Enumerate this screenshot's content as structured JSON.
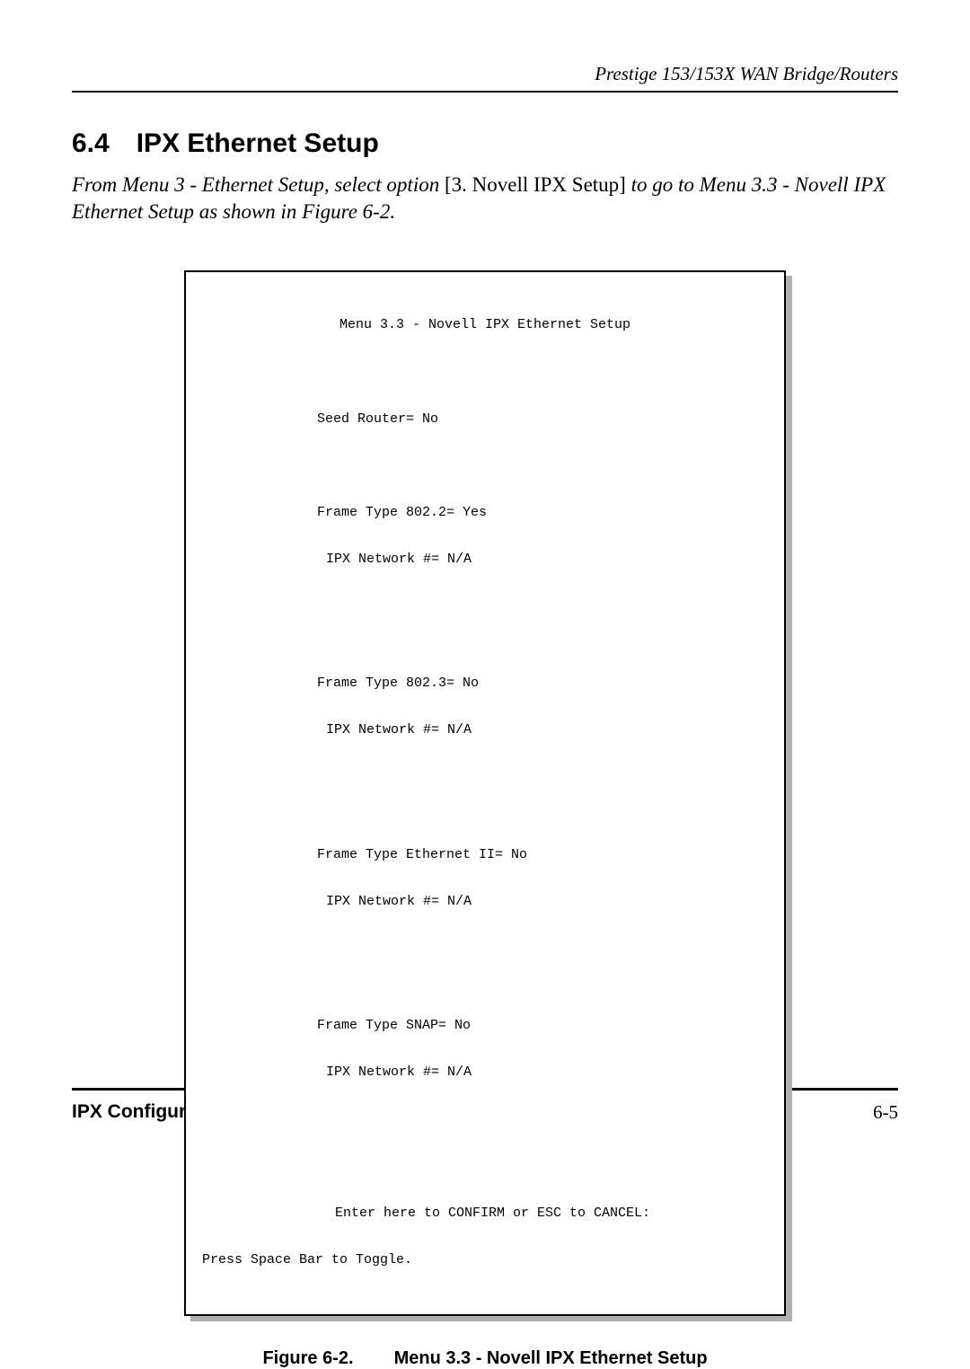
{
  "header": {
    "title": "Prestige 153/153X  WAN Bridge/Routers"
  },
  "section": {
    "number": "6.4",
    "title": "IPX Ethernet Setup"
  },
  "intro": {
    "part1_italic": "From Menu 3 - Ethernet Setup, select option ",
    "part2_plain": "[3. Novell IPX Setup]",
    "part3_italic": "  to go to Menu 3.3 - Novell IPX Ethernet Setup as shown in  Figure 6-2."
  },
  "terminal": {
    "title": "Menu 3.3 - Novell IPX Ethernet Setup",
    "seed_router": "Seed Router= No",
    "frame_8022": "Frame Type 802.2= Yes",
    "ipx_8022": "IPX Network #= N/A",
    "frame_8023": "Frame Type 802.3= No",
    "ipx_8023": "IPX Network #= N/A",
    "frame_eth2": "Frame Type Ethernet II= No",
    "ipx_eth2": "IPX Network #= N/A",
    "frame_snap": "Frame Type SNAP= No",
    "ipx_snap": "IPX Network #= N/A",
    "confirm": "Enter here to CONFIRM or ESC to CANCEL:",
    "toggle": "Press Space Bar to Toggle."
  },
  "figure": {
    "label": "Figure 6-2.",
    "caption": "Menu 3.3 - Novell IPX Ethernet Setup"
  },
  "footer": {
    "section": "IPX Configuration",
    "page": "6-5"
  }
}
